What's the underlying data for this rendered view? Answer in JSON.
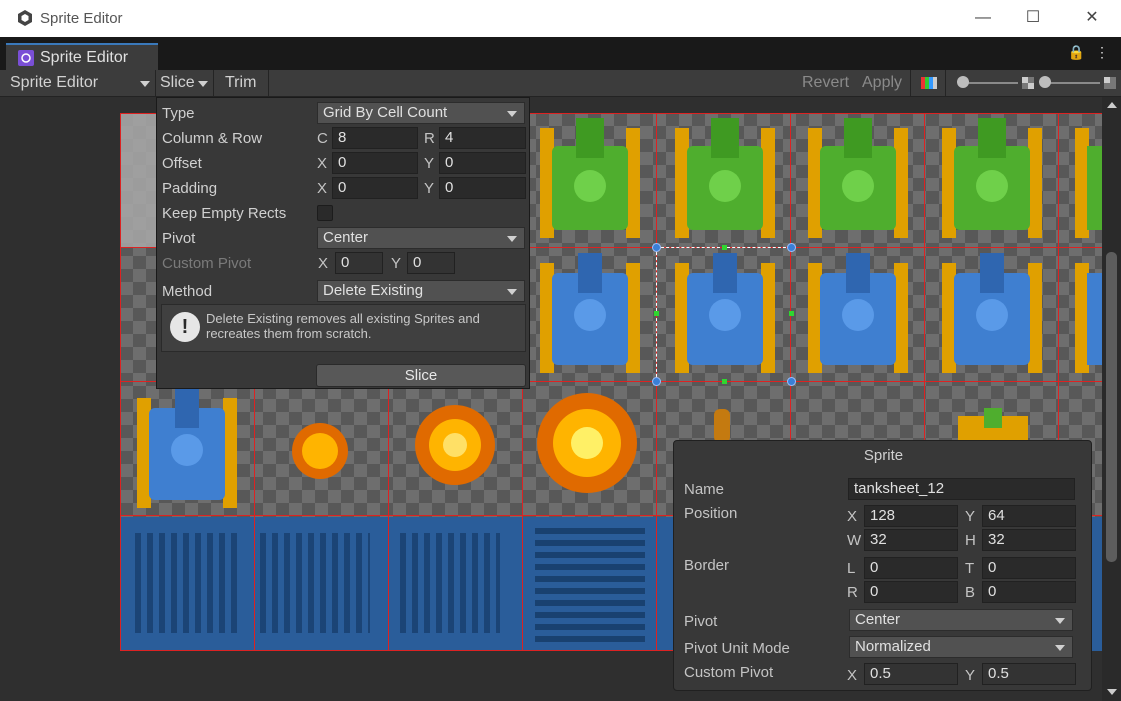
{
  "window": {
    "title": "Sprite Editor",
    "minimize": "—",
    "maximize": "☐",
    "close": "✕"
  },
  "tab": {
    "label": "Sprite Editor"
  },
  "tab_icons": {
    "lock": "🔒",
    "menu": "⋮"
  },
  "toolbar": {
    "mode_label": "Sprite Editor",
    "slice_label": "Slice",
    "trim_label": "Trim",
    "revert_label": "Revert",
    "apply_label": "Apply"
  },
  "slice_popup": {
    "type_label": "Type",
    "type_value": "Grid By Cell Count",
    "colrow_label": "Column & Row",
    "c_label": "C",
    "c_value": "8",
    "r_label": "R",
    "r_value": "4",
    "offset_label": "Offset",
    "offset_x_label": "X",
    "offset_x": "0",
    "offset_y_label": "Y",
    "offset_y": "0",
    "padding_label": "Padding",
    "padding_x_label": "X",
    "padding_x": "0",
    "padding_y_label": "Y",
    "padding_y": "0",
    "keep_empty_label": "Keep Empty Rects",
    "keep_empty_checked": false,
    "pivot_label": "Pivot",
    "pivot_value": "Center",
    "custom_pivot_label": "Custom Pivot",
    "cp_x_label": "X",
    "cp_x": "0",
    "cp_y_label": "Y",
    "cp_y": "0",
    "method_label": "Method",
    "method_value": "Delete Existing",
    "help_icon": "!",
    "help_text": "Delete Existing removes all existing Sprites and recreates them from scratch.",
    "slice_button": "Slice"
  },
  "sprite_panel": {
    "title": "Sprite",
    "name_label": "Name",
    "name_value": "tanksheet_12",
    "position_label": "Position",
    "x_label": "X",
    "x_value": "128",
    "y_label": "Y",
    "y_value": "64",
    "w_label": "W",
    "w_value": "32",
    "h_label": "H",
    "h_value": "32",
    "border_label": "Border",
    "l_label": "L",
    "l_value": "0",
    "t_label": "T",
    "t_value": "0",
    "r_label": "R",
    "r_value": "0",
    "b_label": "B",
    "b_value": "0",
    "pivot_label": "Pivot",
    "pivot_value": "Center",
    "pivot_unit_label": "Pivot Unit Mode",
    "pivot_unit_value": "Normalized",
    "custom_pivot_label": "Custom Pivot",
    "cp_x_label": "X",
    "cp_x": "0.5",
    "cp_y_label": "Y",
    "cp_y": "0.5"
  },
  "colors": {
    "slice_line": "#dd2222",
    "accent": "#3a79bb",
    "green_tank": "#4fae2e",
    "blue_tank": "#3f7fd0",
    "tread": "#e0a000"
  }
}
